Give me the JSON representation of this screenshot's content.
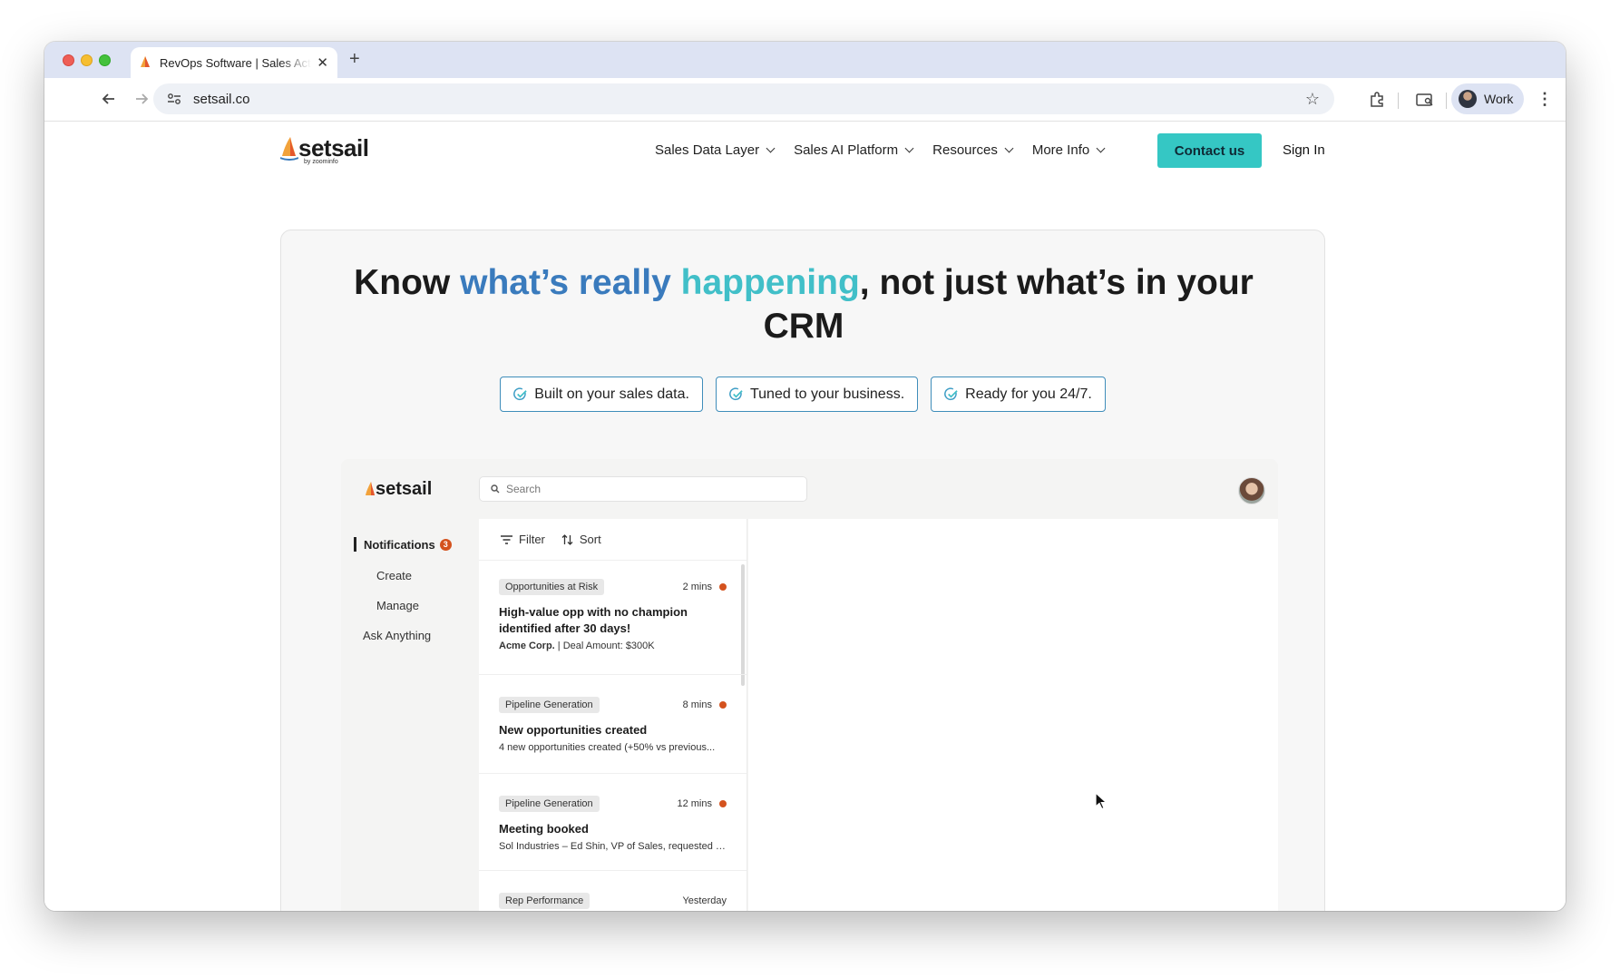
{
  "browser": {
    "tab_title": "RevOps Software | Sales Activity",
    "tab_close": "✕",
    "new_tab": "+",
    "url": "setsail.co",
    "profile_name": "Work"
  },
  "site": {
    "logo": "setsail",
    "logo_sub": "by zoominfo",
    "nav": [
      "Sales Data Layer",
      "Sales AI Platform",
      "Resources",
      "More Info"
    ],
    "contact": "Contact us",
    "signin": "Sign In",
    "brand_teal": "#35c7c4"
  },
  "hero": {
    "headline_1": "Know ",
    "headline_blue": "what’s really ",
    "headline_teal": "happening",
    "headline_2": ", not just what’s in your CRM",
    "pills": [
      "Built on your sales data.",
      "Tuned to your business.",
      "Ready for you 24/7."
    ]
  },
  "app": {
    "logo": "setsail",
    "search_placeholder": "Search",
    "sidebar": {
      "notifications": "Notifications",
      "notifications_count": "3",
      "create": "Create",
      "manage": "Manage",
      "ask": "Ask Anything"
    },
    "filter": "Filter",
    "sort": "Sort",
    "cards": [
      {
        "tag": "Opportunities at Risk",
        "time": "2 mins",
        "title": "High-value opp with no champion identified after 30 days!",
        "sub_bold": "Acme Corp.",
        "sub": " | Deal Amount: $300K"
      },
      {
        "tag": "Pipeline Generation",
        "time": "8 mins",
        "title": "New opportunities created",
        "sub_bold": "",
        "sub": "4 new opportunities created (+50% vs previous..."
      },
      {
        "tag": "Pipeline Generation",
        "time": "12 mins",
        "title": "Meeting booked",
        "sub_bold": "",
        "sub": "Sol Industries – Ed Shin, VP of Sales, requested a..."
      },
      {
        "tag": "Rep Performance",
        "time": "Yesterday",
        "title": "",
        "sub_bold": "",
        "sub": ""
      }
    ]
  }
}
